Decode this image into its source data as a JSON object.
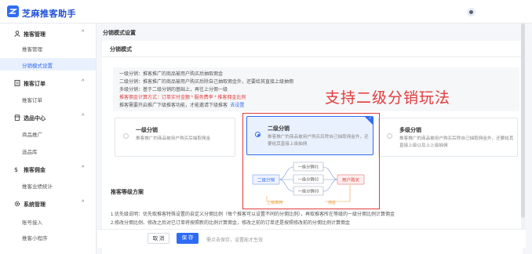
{
  "app": {
    "title": "芝麻推客助手"
  },
  "sidebar": {
    "groups": [
      {
        "label": "推客管理",
        "arrow": "^",
        "items": [
          {
            "label": "推客管理"
          },
          {
            "label": "分销模式设置"
          }
        ]
      },
      {
        "label": "推客订单",
        "arrow": "^",
        "items": [
          {
            "label": "推客订单"
          }
        ]
      },
      {
        "label": "选品中心",
        "arrow": "^",
        "items": [
          {
            "label": "商品推广"
          },
          {
            "label": "选品库"
          }
        ]
      },
      {
        "label": "推客佣金",
        "arrow": "^",
        "items": [
          {
            "label": "推客业绩统计"
          }
        ]
      },
      {
        "label": "系统管理",
        "arrow": "^",
        "items": [
          {
            "label": "账号接入"
          },
          {
            "label": "推客小程序"
          }
        ]
      }
    ]
  },
  "main": {
    "page_title": "分销模式设置",
    "section_title": "分销模式",
    "description": {
      "line1": "一级分销：推客推广的商品被用户购买后抽取佣金",
      "line2": "二级分销：推客推广的商品被用户购买后除自己抽取佣金外，还要给其直接上级抽佣",
      "line3": "多级分销：基于二级分销的基础上，再往上分佣一级",
      "line4": "推客佣金计算方式：订单实付金额 * 服务费率 * 推客佣金比例",
      "line5_text": "推客需要开启推广下级推客功能，才能邀请下级推客",
      "line5_link": "去设置"
    },
    "banner": "支持二级分销玩法",
    "options": [
      {
        "title": "一级分销",
        "desc": "推客推广的商品被用户购买后抽取佣金"
      },
      {
        "title": "二级分销",
        "desc": "推客推广的商品被用户购买后除自己抽取佣金外，还要给其直接上级抽佣"
      },
      {
        "title": "多级分销",
        "desc": "推客推广的商品被用户购买后除自己抽取佣金外，还要给其直接上级以及上上级抽佣"
      }
    ],
    "selected_option": "二级分销",
    "diagram": {
      "level2": "二级分销",
      "branches": [
        "一级分销01",
        "一级分销02",
        "一级分销03"
      ],
      "target": "用户购买",
      "upstream": "上级推佣",
      "commission": "佣金"
    },
    "section2_title": "推客等级方案",
    "notes": {
      "line1": "1.优先级说明：优先取推客特殊设置的自定义分佣比例（每个推客可以设置不同的分佣比例），再取推客所在等级的一级分佣比例计算佣金",
      "line2": "2.修改分佣比例、修改之后对已订单将按照新的比例计算佣金，修改之前的订单还是按照修改前的分佣比例计算佣金"
    }
  },
  "footer": {
    "cancel_label": "取 消",
    "save_label": "保 存",
    "hint": "需点击保存，设置能才生效"
  },
  "colors": {
    "accent": "#2f6cf6",
    "highlight": "#e23b3b"
  }
}
